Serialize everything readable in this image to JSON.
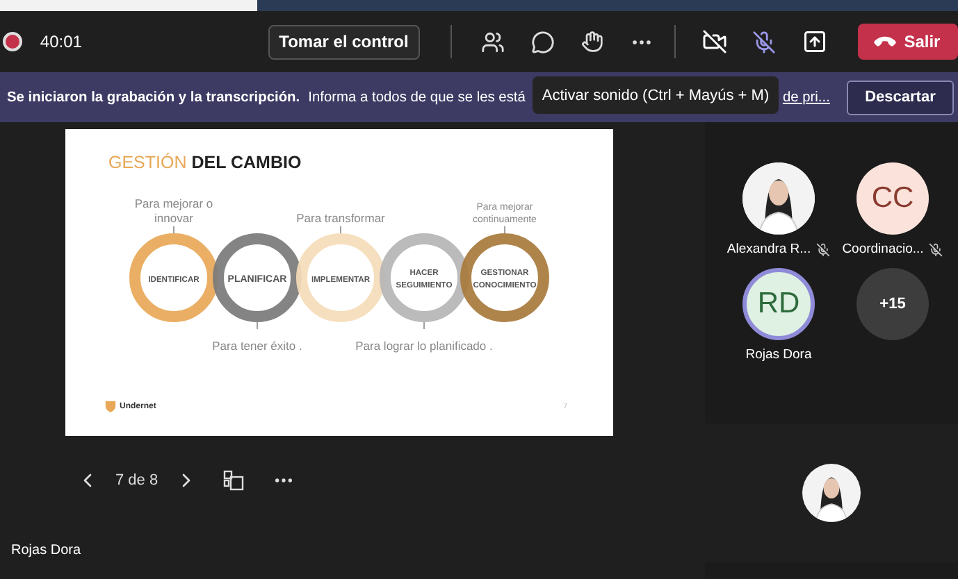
{
  "top_bar": {
    "recording": true,
    "timer": "40:01",
    "take_control": "Tomar el control",
    "camera_off": true,
    "mic_muted": true,
    "leave": "Salir"
  },
  "banner": {
    "bold": "Se iniciaron la grabación y la transcripción.",
    "text": "Informa a todos de que se les está",
    "link": "de pri...",
    "dismiss": "Descartar"
  },
  "tooltip": "Activar sonido (Ctrl + Mayús + M)",
  "slide": {
    "title_accent": "GESTIÓN",
    "title_rest": "DEL CAMBIO",
    "steps": [
      {
        "label_lines": [
          "IDENTIFICAR"
        ],
        "color": "#e8a857",
        "note_lines": [
          "Para mejorar o",
          "innovar"
        ]
      },
      {
        "label_lines": [
          "PLANIFICAR"
        ],
        "color": "#7a7a7a",
        "note_lines": [
          "Para tener éxito ."
        ]
      },
      {
        "label_lines": [
          "IMPLEMENTAR"
        ],
        "color": "#f5dcb8",
        "note_lines": [
          "Para transformar"
        ]
      },
      {
        "label_lines": [
          "HACER",
          "SEGUIMIENTO"
        ],
        "color": "#b5b5b5",
        "note_lines": [
          "Para lograr lo planificado ."
        ]
      },
      {
        "label_lines": [
          "GESTIONAR",
          "CONOCIMIENTO"
        ],
        "color": "#a87a3c",
        "note_lines": [
          "Para mejorar",
          "continuamente"
        ]
      }
    ],
    "logo": "Undernet",
    "page": "7"
  },
  "pager": "7 de 8",
  "presenter": "Rojas Dora",
  "participants": [
    {
      "name": "Alexandra R...",
      "muted": true,
      "speaking": false
    },
    {
      "kind": "initials",
      "initials": "CC",
      "name": "Coordinacio...",
      "muted": true,
      "speaking": false
    },
    {
      "kind": "initials",
      "initials": "RD",
      "name": "Rojas Dora",
      "muted": false,
      "speaking": true
    }
  ],
  "overflow": "+15"
}
